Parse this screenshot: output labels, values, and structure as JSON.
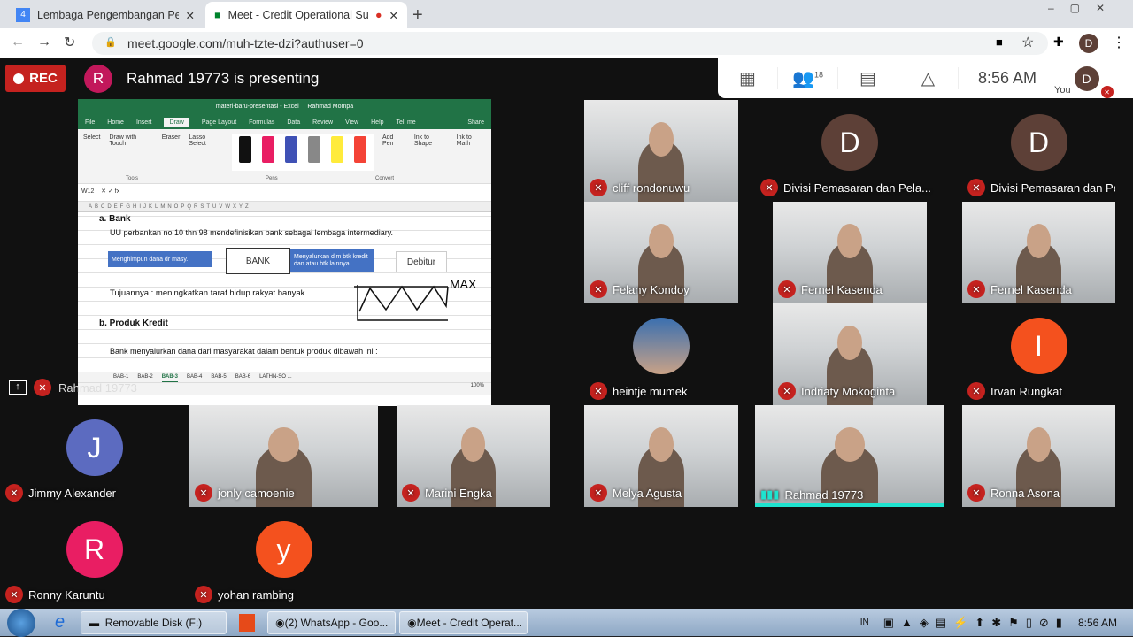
{
  "browser": {
    "tabs": [
      {
        "title": "Lembaga Pengembangan Perbar",
        "icon": "google-calendar-icon"
      },
      {
        "title": "Meet - Credit Operational Su",
        "icon": "google-meet-icon",
        "recording": true
      }
    ],
    "url": "meet.google.com/muh-tzte-dzi?authuser=0",
    "profile_initial": "D"
  },
  "meet": {
    "rec_label": "REC",
    "presenter_initial": "R",
    "presenter_text": "Rahmad 19773 is presenting",
    "participant_count": "18",
    "time": "8:56 AM",
    "you_label": "You",
    "you_initial": "D",
    "presentation_tile_name": "Rahmad 19773"
  },
  "excel": {
    "title": "materi-baru-presentasi - Excel",
    "user": "Rahmad Mompa",
    "ribbon_tabs": [
      "File",
      "Home",
      "Insert",
      "Draw",
      "Page Layout",
      "Formulas",
      "Data",
      "Review",
      "View",
      "Help",
      "Tell me",
      "Share"
    ],
    "active_tab": "Draw",
    "tools": [
      "Select",
      "Draw with Touch",
      "Eraser",
      "Lasso Select",
      "Add Pen",
      "Ink to Shape",
      "Ink to Math"
    ],
    "groups": [
      "Tools",
      "Pens",
      "Convert"
    ],
    "name_box": "W12",
    "cells": {
      "heading_a": "a. Bank",
      "line8": "UU perbankan  no  10 thn 98  mendefinisikan bank sebagai lembaga intermediary.",
      "arrow1": "Menghimpun dana dr masy.",
      "bank": "BANK",
      "arrow2": "Menyalurkan dlm btk kredit dan atau btk lainnya",
      "debitur": "Debitur",
      "tujuan": "Tujuannya : meningkatkan taraf hidup rakyat banyak",
      "heading_b": "b. Produk Kredit",
      "line17": "Bank menyalurkan dana dari masyarakat dalam bentuk produk dibawah ini :",
      "ink": "MAX"
    },
    "sheets": [
      "BAB-1",
      "BAB-2",
      "BAB-3",
      "BAB-4",
      "BAB-5",
      "BAB-6",
      "LATHN-SO ..."
    ],
    "active_sheet": "BAB-3",
    "zoom": "100%"
  },
  "participants": [
    {
      "name": "cliff rondonuwu",
      "type": "video"
    },
    {
      "name": "Divisi Pemasaran dan Pela...",
      "initial": "D",
      "color": "#5d4037"
    },
    {
      "name": "Divisi Pemasaran dan Pela...",
      "initial": "D",
      "color": "#5d4037"
    },
    {
      "name": "Felany Kondoy",
      "type": "video"
    },
    {
      "name": "Fernel Kasenda",
      "type": "video"
    },
    {
      "name": "Fernel Kasenda",
      "type": "video"
    },
    {
      "name": "heintje mumek",
      "type": "photo"
    },
    {
      "name": "Indriaty Mokoginta",
      "type": "video"
    },
    {
      "name": "Irvan Rungkat",
      "initial": "I",
      "color": "#f4511e"
    },
    {
      "name": "Jimmy Alexander",
      "initial": "J",
      "color": "#5c6bc0"
    },
    {
      "name": "jonly camoenie",
      "type": "video"
    },
    {
      "name": "Marini Engka",
      "type": "video"
    },
    {
      "name": "Melya Agusta",
      "type": "video"
    },
    {
      "name": "Rahmad 19773",
      "type": "video",
      "speaking": true
    },
    {
      "name": "Ronna Asona",
      "type": "video"
    },
    {
      "name": "Ronny Karuntu",
      "initial": "R",
      "color": "#e91e63"
    },
    {
      "name": "yohan rambing",
      "initial": "y",
      "color": "#f4511e"
    }
  ],
  "taskbar": {
    "items": [
      "Removable Disk (F:)",
      "(2) WhatsApp - Goo...",
      "Meet - Credit Operat..."
    ],
    "lang": "IN",
    "time": "8:56 AM"
  }
}
